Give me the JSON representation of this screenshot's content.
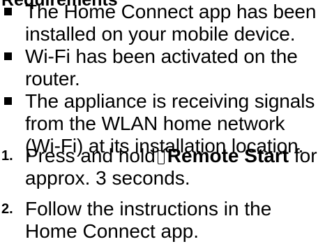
{
  "section": {
    "heading": "Requirements",
    "requirements": [
      "The Home Connect app has been installed on your mobile device.",
      "Wi-Fi has been activated on the router.",
      "The appliance is receiving signals from the WLAN home network (Wi-Fi) at its installation location."
    ]
  },
  "steps": [
    {
      "number": "1.",
      "before": "Press and hold",
      "icon": "remote-start-icon",
      "button": "Remote Start",
      "after": "for approx. 3 seconds."
    },
    {
      "number": "2.",
      "text": "Follow the instructions in the Home Connect app."
    }
  ]
}
